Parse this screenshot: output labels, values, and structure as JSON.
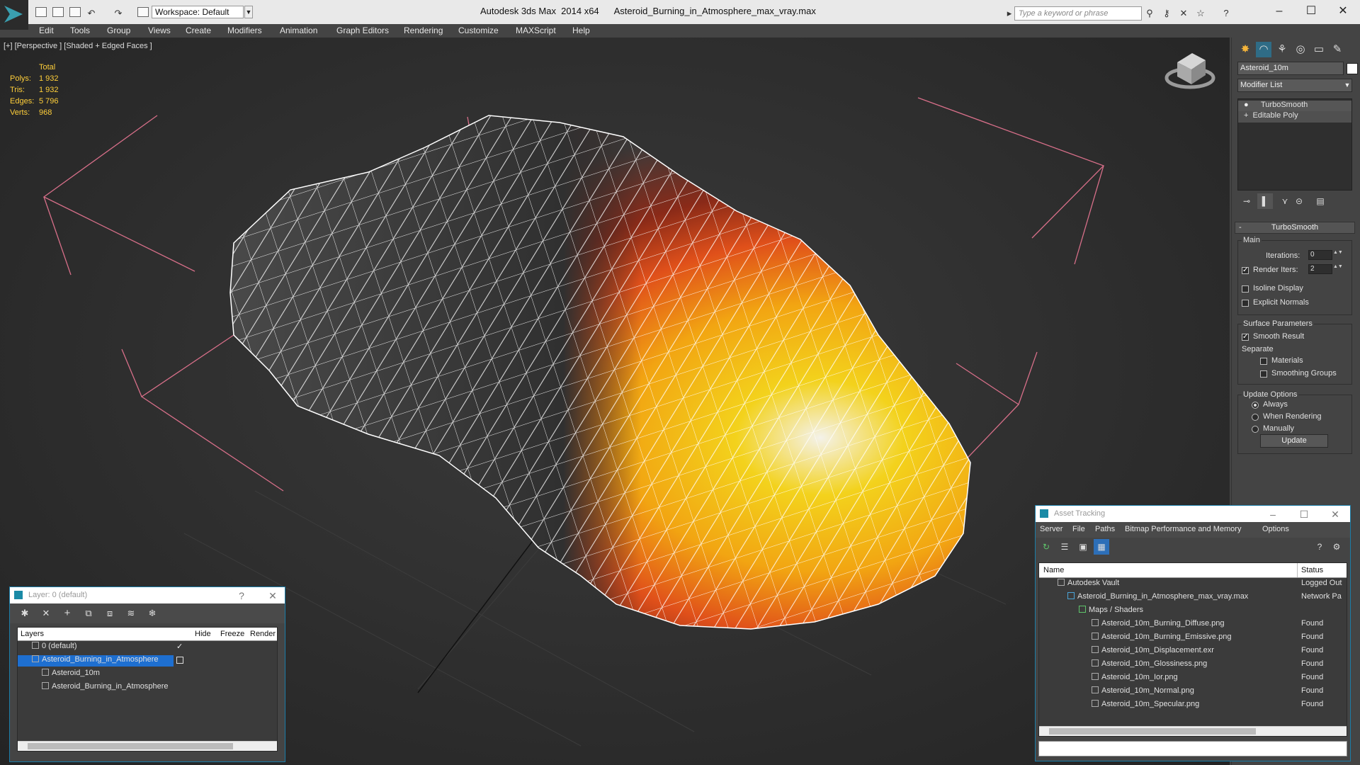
{
  "app": {
    "workspace": "Workspace: Default",
    "title": "Autodesk 3ds Max  2014 x64",
    "filename": "Asteroid_Burning_in_Atmosphere_max_vray.max",
    "search_placeholder": "Type a keyword or phrase"
  },
  "menu": [
    "Edit",
    "Tools",
    "Group",
    "Views",
    "Create",
    "Modifiers",
    "Animation",
    "Graph Editors",
    "Rendering",
    "Customize",
    "MAXScript",
    "Help"
  ],
  "viewport": {
    "label": "[+] [Perspective ] [Shaded + Edged Faces ]",
    "stats": {
      "header": "Total",
      "rows": [
        {
          "label": "Polys:",
          "value": "1 932"
        },
        {
          "label": "Tris:",
          "value": "1 932"
        },
        {
          "label": "Edges:",
          "value": "5 796"
        },
        {
          "label": "Verts:",
          "value": "968"
        }
      ]
    }
  },
  "command_panel": {
    "object_name": "Asteroid_10m",
    "modifier_list": "Modifier List",
    "stack": [
      "TurboSmooth",
      "Editable Poly"
    ],
    "rollout_title": "TurboSmooth",
    "main_label": "Main",
    "iterations_label": "Iterations:",
    "iterations_value": "0",
    "render_iters_label": "Render Iters:",
    "render_iters_value": "2",
    "isoline_display": "Isoline Display",
    "explicit_normals": "Explicit Normals",
    "surface_parameters": "Surface Parameters",
    "smooth_result": "Smooth Result",
    "separate": "Separate",
    "materials": "Materials",
    "smoothing_groups": "Smoothing Groups",
    "update_options": "Update Options",
    "always": "Always",
    "when_rendering": "When Rendering",
    "manually": "Manually",
    "update_button": "Update"
  },
  "layer_window": {
    "title": "Layer: 0 (default)",
    "columns": [
      "Layers",
      "Hide",
      "Freeze",
      "Render"
    ],
    "rows": [
      "0 (default)",
      "Asteroid_Burning_in_Atmosphere",
      "Asteroid_10m",
      "Asteroid_Burning_in_Atmosphere"
    ]
  },
  "asset_window": {
    "title": "Asset Tracking",
    "menu": [
      "Server",
      "File",
      "Paths",
      "Bitmap Performance and Memory",
      "Options"
    ],
    "columns": [
      "Name",
      "Status"
    ],
    "rows": [
      {
        "name": "Autodesk Vault",
        "status": "Logged Out"
      },
      {
        "name": "Asteroid_Burning_in_Atmosphere_max_vray.max",
        "status": "Network Pa"
      },
      {
        "name": "Maps / Shaders",
        "status": ""
      },
      {
        "name": "Asteroid_10m_Burning_Diffuse.png",
        "status": "Found"
      },
      {
        "name": "Asteroid_10m_Burning_Emissive.png",
        "status": "Found"
      },
      {
        "name": "Asteroid_10m_Displacement.exr",
        "status": "Found"
      },
      {
        "name": "Asteroid_10m_Glossiness.png",
        "status": "Found"
      },
      {
        "name": "Asteroid_10m_Ior.png",
        "status": "Found"
      },
      {
        "name": "Asteroid_10m_Normal.png",
        "status": "Found"
      },
      {
        "name": "Asteroid_10m_Specular.png",
        "status": "Found"
      }
    ]
  }
}
